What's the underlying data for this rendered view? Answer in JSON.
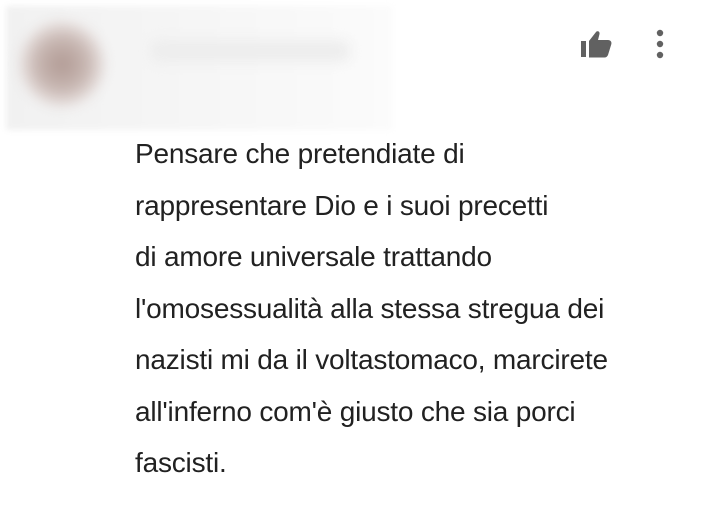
{
  "comment": {
    "author_name": "",
    "like_icon": "thumb-up-icon",
    "menu_icon": "more-vert-icon",
    "lines": [
      "Pensare che pretendiate di",
      "rappresentare Dio e i suoi precetti",
      "di amore universale trattando",
      "l'omosessualità alla stessa stregua dei",
      "nazisti mi da il voltastomaco, marcirete",
      "all'inferno com'è giusto che sia porci",
      "fascisti."
    ]
  },
  "colors": {
    "text": "#212121",
    "icon": "#616161",
    "background": "#ffffff"
  }
}
